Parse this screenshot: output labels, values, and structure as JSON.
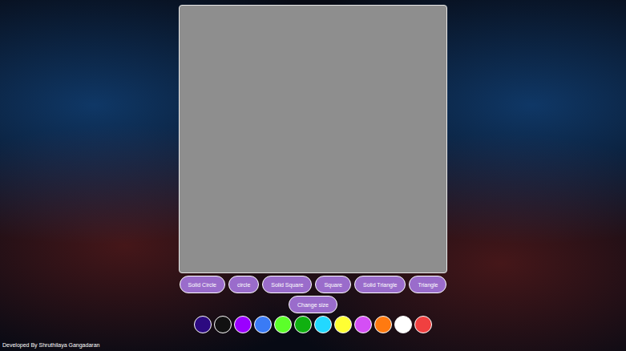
{
  "canvas": {
    "kind": "drawing-area"
  },
  "shape_buttons": [
    "Solid Circle",
    "circle",
    "Solid Square",
    "Square",
    "Solid Triangle",
    "Triangle"
  ],
  "size_button": "Change size",
  "palette": [
    {
      "color": "#2c0a80"
    },
    {
      "color": "#111111"
    },
    {
      "color": "#9b00ff"
    },
    {
      "color": "#3a7bf5"
    },
    {
      "color": "#5cff2a"
    },
    {
      "color": "#10b010"
    },
    {
      "color": "#22d8ff"
    },
    {
      "color": "#ffff33"
    },
    {
      "color": "#d44ff5"
    },
    {
      "color": "#ff7a10"
    },
    {
      "color": "#ffffff"
    },
    {
      "color": "#f04040"
    }
  ],
  "footer": "Developed By Shruthilaya Gangadaran"
}
